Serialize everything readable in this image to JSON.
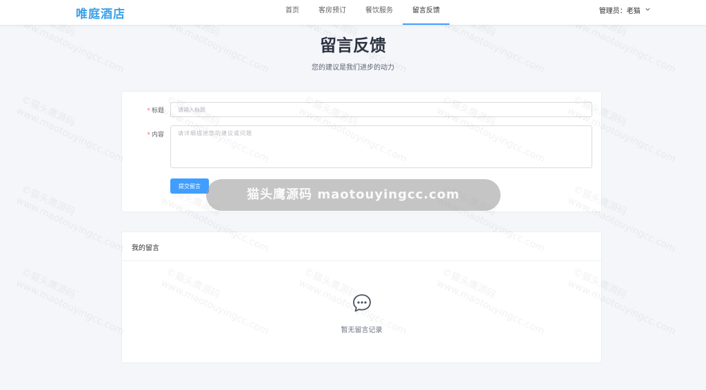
{
  "header": {
    "logo": "唯庭酒店",
    "nav": [
      {
        "label": "首页",
        "active": false
      },
      {
        "label": "客房预订",
        "active": false
      },
      {
        "label": "餐饮服务",
        "active": false
      },
      {
        "label": "留言反馈",
        "active": true
      }
    ],
    "user_label": "管理员：老猫"
  },
  "page": {
    "title": "留言反馈",
    "subtitle": "您的建议是我们进步的动力"
  },
  "form": {
    "title_label": "标题",
    "title_placeholder": "请输入标题",
    "content_label": "内容",
    "content_placeholder": "请详细描述您的建议或问题",
    "submit_label": "提交留言",
    "required_mark": "*"
  },
  "messages": {
    "header": "我的留言",
    "empty_text": "暂无留言记录"
  },
  "watermark": {
    "banner": "猫头鹰源码 maotouyingcc.com",
    "tile_line1": "©猫头鹰源码",
    "tile_line2": "www.maotouyingcc.com"
  },
  "colors": {
    "accent": "#409eff",
    "logo": "#3aa0e8",
    "background": "#f4f6fa",
    "required": "#f56c6c"
  }
}
